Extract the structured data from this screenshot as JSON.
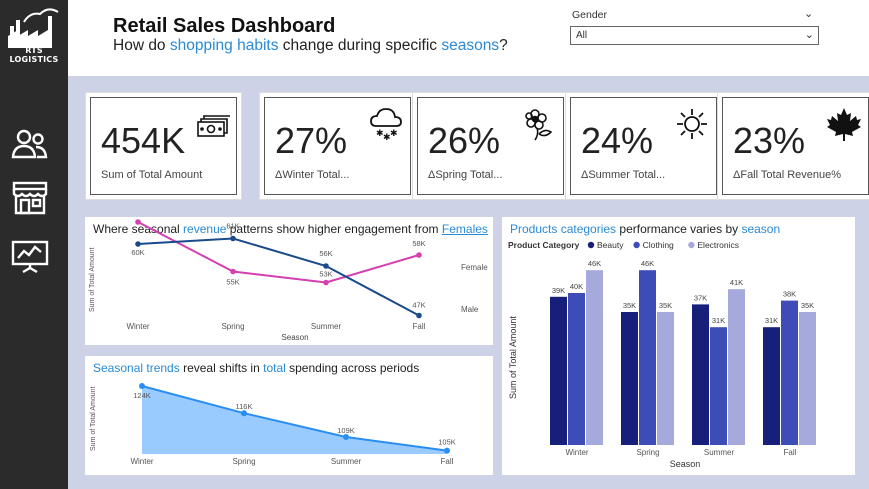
{
  "sidebar": {
    "logo_text": "RTS LOGISTICS",
    "nav": [
      {
        "name": "customers-icon"
      },
      {
        "name": "store-icon"
      },
      {
        "name": "analytics-board-icon"
      }
    ]
  },
  "header": {
    "title": "Retail Sales Dashboard",
    "subtitle_parts": [
      "How do ",
      "shopping habits",
      " change during specific ",
      "seasons",
      "?"
    ]
  },
  "slicer": {
    "label": "Gender",
    "value": "All"
  },
  "kpis": [
    {
      "value": "454K",
      "label": "Sum of Total Amount",
      "icon": "money-stack-icon"
    },
    {
      "value": "27%",
      "label": "ΔWinter Total...",
      "icon": "snow-cloud-icon"
    },
    {
      "value": "26%",
      "label": "ΔSpring Total...",
      "icon": "flower-icon"
    },
    {
      "value": "24%",
      "label": "ΔSummer Total...",
      "icon": "sun-icon"
    },
    {
      "value": "23%",
      "label": "ΔFall Total Revenue%",
      "icon": "maple-leaf-icon"
    }
  ],
  "line_panel": {
    "title_parts": [
      "Where seasonal ",
      "revenue",
      " patterns show higher engagement from ",
      "Females"
    ]
  },
  "area_panel": {
    "title_parts": [
      "Seasonal trends",
      " reveal shifts in ",
      "total",
      " spending across periods"
    ]
  },
  "bar_panel": {
    "title_parts": [
      "Products categories",
      " performance varies by ",
      "season"
    ]
  },
  "chart_data": [
    {
      "type": "line",
      "x": [
        "Winter",
        "Spring",
        "Summer",
        "Fall"
      ],
      "xlabel": "Season",
      "ylabel": "Sum of Total Amount",
      "series": [
        {
          "name": "Female",
          "values": [
            64,
            55,
            53,
            58
          ],
          "labels": [
            "64K",
            "55K",
            "53K",
            "58K"
          ],
          "color": "#d63fb0"
        },
        {
          "name": "Male",
          "values": [
            60,
            61,
            56,
            47
          ],
          "labels": [
            "60K",
            "61K",
            "56K",
            "47K"
          ],
          "color": "#1a4a8a"
        }
      ]
    },
    {
      "type": "area",
      "x": [
        "Winter",
        "Spring",
        "Summer",
        "Fall"
      ],
      "ylabel": "Sum of Total Amount",
      "values": [
        124,
        116,
        109,
        105
      ],
      "labels": [
        "124K",
        "116K",
        "109K",
        "105K"
      ],
      "color": "#2a8ef0"
    },
    {
      "type": "bar",
      "categories": [
        "Winter",
        "Spring",
        "Summer",
        "Fall"
      ],
      "xlabel": "Season",
      "ylabel": "Sum of Total Amount",
      "legend_title": "Product Category",
      "series": [
        {
          "name": "Beauty",
          "values": [
            39,
            35,
            37,
            31
          ],
          "labels": [
            "39K",
            "35K",
            "37K",
            "31K"
          ],
          "color": "#16207a"
        },
        {
          "name": "Clothing",
          "values": [
            40,
            46,
            31,
            38
          ],
          "labels": [
            "40K",
            "46K",
            "31K",
            "38K"
          ],
          "color": "#3e4cb8"
        },
        {
          "name": "Electronics",
          "values": [
            46,
            35,
            41,
            35
          ],
          "labels": [
            "46K",
            "35K",
            "41K",
            "35K"
          ],
          "color": "#a5a9dc"
        }
      ]
    }
  ]
}
